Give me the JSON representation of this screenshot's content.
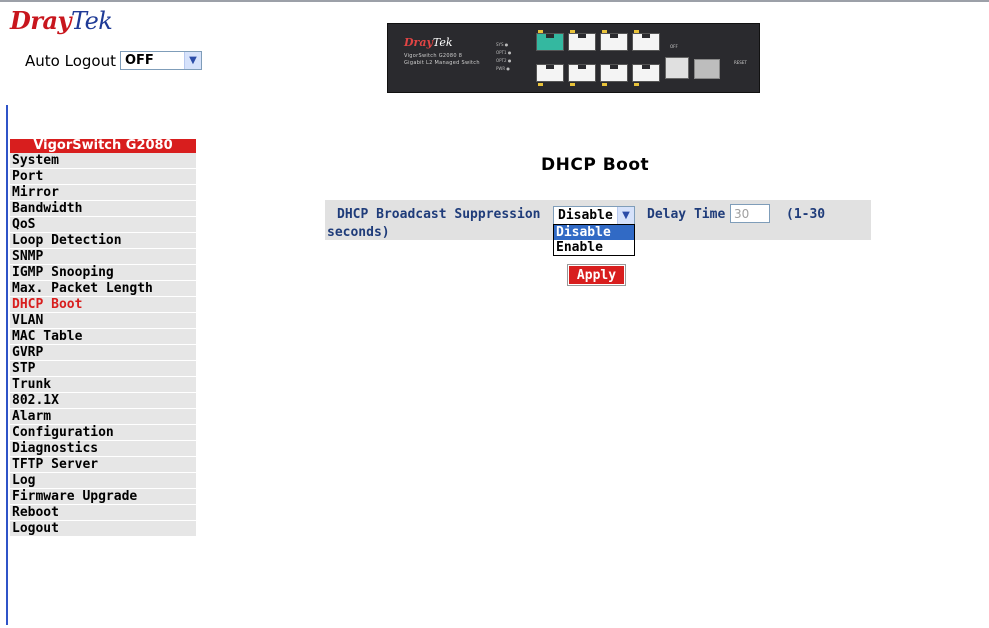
{
  "header": {
    "logo_dray": "Dray",
    "logo_tek": "Tek",
    "auto_logout_label": "Auto Logout",
    "auto_logout_value": "OFF"
  },
  "device_image": {
    "logo_dray": "Dray",
    "logo_tek": "Tek",
    "subtitle": "VigorSwitch G2080 8 Gigabit L2 Managed Switch",
    "leds": "SYS ● OPT1 ● OPT2 ● PWR ●",
    "off_label": "OFF",
    "reset_label": "RESET"
  },
  "sidebar": {
    "title": "VigorSwitch G2080",
    "items": [
      {
        "label": "System",
        "active": false
      },
      {
        "label": "Port",
        "active": false
      },
      {
        "label": "Mirror",
        "active": false
      },
      {
        "label": "Bandwidth",
        "active": false
      },
      {
        "label": "QoS",
        "active": false
      },
      {
        "label": "Loop Detection",
        "active": false
      },
      {
        "label": "SNMP",
        "active": false
      },
      {
        "label": "IGMP Snooping",
        "active": false
      },
      {
        "label": "Max. Packet Length",
        "active": false
      },
      {
        "label": "DHCP Boot",
        "active": true
      },
      {
        "label": "VLAN",
        "active": false
      },
      {
        "label": "MAC Table",
        "active": false
      },
      {
        "label": "GVRP",
        "active": false
      },
      {
        "label": "STP",
        "active": false
      },
      {
        "label": "Trunk",
        "active": false
      },
      {
        "label": "802.1X",
        "active": false
      },
      {
        "label": "Alarm",
        "active": false
      },
      {
        "label": "Configuration",
        "active": false
      },
      {
        "label": "Diagnostics",
        "active": false
      },
      {
        "label": "TFTP Server",
        "active": false
      },
      {
        "label": "Log",
        "active": false
      },
      {
        "label": "Firmware Upgrade",
        "active": false
      },
      {
        "label": "Reboot",
        "active": false
      },
      {
        "label": "Logout",
        "active": false
      }
    ]
  },
  "main": {
    "title": "DHCP Boot",
    "broadcast_label": "DHCP Broadcast Suppression",
    "broadcast_value": "Disable",
    "broadcast_options": [
      "Disable",
      "Enable"
    ],
    "delay_label": "Delay Time",
    "delay_value": "30",
    "range_label": "(1-30",
    "range_label_cont": "seconds)",
    "apply_label": "Apply"
  },
  "colors": {
    "accent_red": "#d81e1e",
    "label_blue": "#1f3c7a",
    "selection_blue": "#316ac5"
  }
}
